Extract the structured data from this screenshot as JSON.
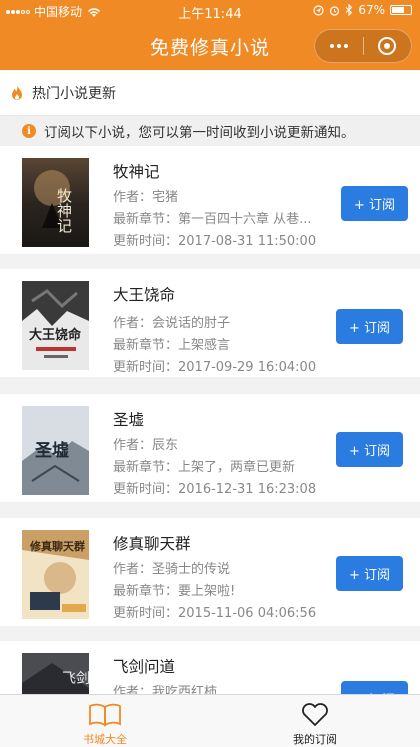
{
  "status_bar": {
    "carrier": "中国移动",
    "time": "上午11:44",
    "battery": "67%",
    "battery_level": 0.67,
    "icons": [
      "signal-icon",
      "wifi-icon",
      "location-icon",
      "alarm-icon",
      "bluetooth-icon",
      "battery-icon"
    ]
  },
  "nav": {
    "title": "免费修真小说",
    "capsule_icons": [
      "more-icon",
      "close-mini-program-icon"
    ]
  },
  "section_header": {
    "icon": "flame-icon",
    "label": "热门小说更新"
  },
  "notice": {
    "icon": "info-icon",
    "text": "订阅以下小说，您可以第一时间收到小说更新通知。"
  },
  "labels": {
    "author": "作者：",
    "latest_chapter": "最新章节：",
    "update_time": "更新时间：",
    "subscribe": "+ 订阅"
  },
  "books": [
    {
      "title": "牧神记",
      "author": "宅猪",
      "latest": "第一百四十六章 从巷...",
      "updated": "2017-08-31 11:50:00",
      "cover_text": "牧神记"
    },
    {
      "title": "大王饶命",
      "author": "会说话的肘子",
      "latest": "上架感言",
      "updated": "2017-09-29 16:04:00",
      "cover_text": "大王饶命"
    },
    {
      "title": "圣墟",
      "author": "辰东",
      "latest": "上架了，两章已更新",
      "updated": "2016-12-31 16:23:08",
      "cover_text": "圣墟"
    },
    {
      "title": "修真聊天群",
      "author": "圣骑士的传说",
      "latest": "要上架啦!",
      "updated": "2015-11-06 04:06:56",
      "cover_text": "修真聊天群"
    },
    {
      "title": "飞剑问道",
      "author": "我吃西红柿",
      "latest": "",
      "updated": "",
      "cover_text": "飞剑问道"
    }
  ],
  "tabs": [
    {
      "label": "书城大全",
      "icon": "book-icon",
      "active": true
    },
    {
      "label": "我的订阅",
      "icon": "heart-icon",
      "active": false
    }
  ],
  "colors": {
    "brand_orange": "#f08a24",
    "button_blue": "#2a7ce0",
    "meta_gray": "#888888"
  }
}
